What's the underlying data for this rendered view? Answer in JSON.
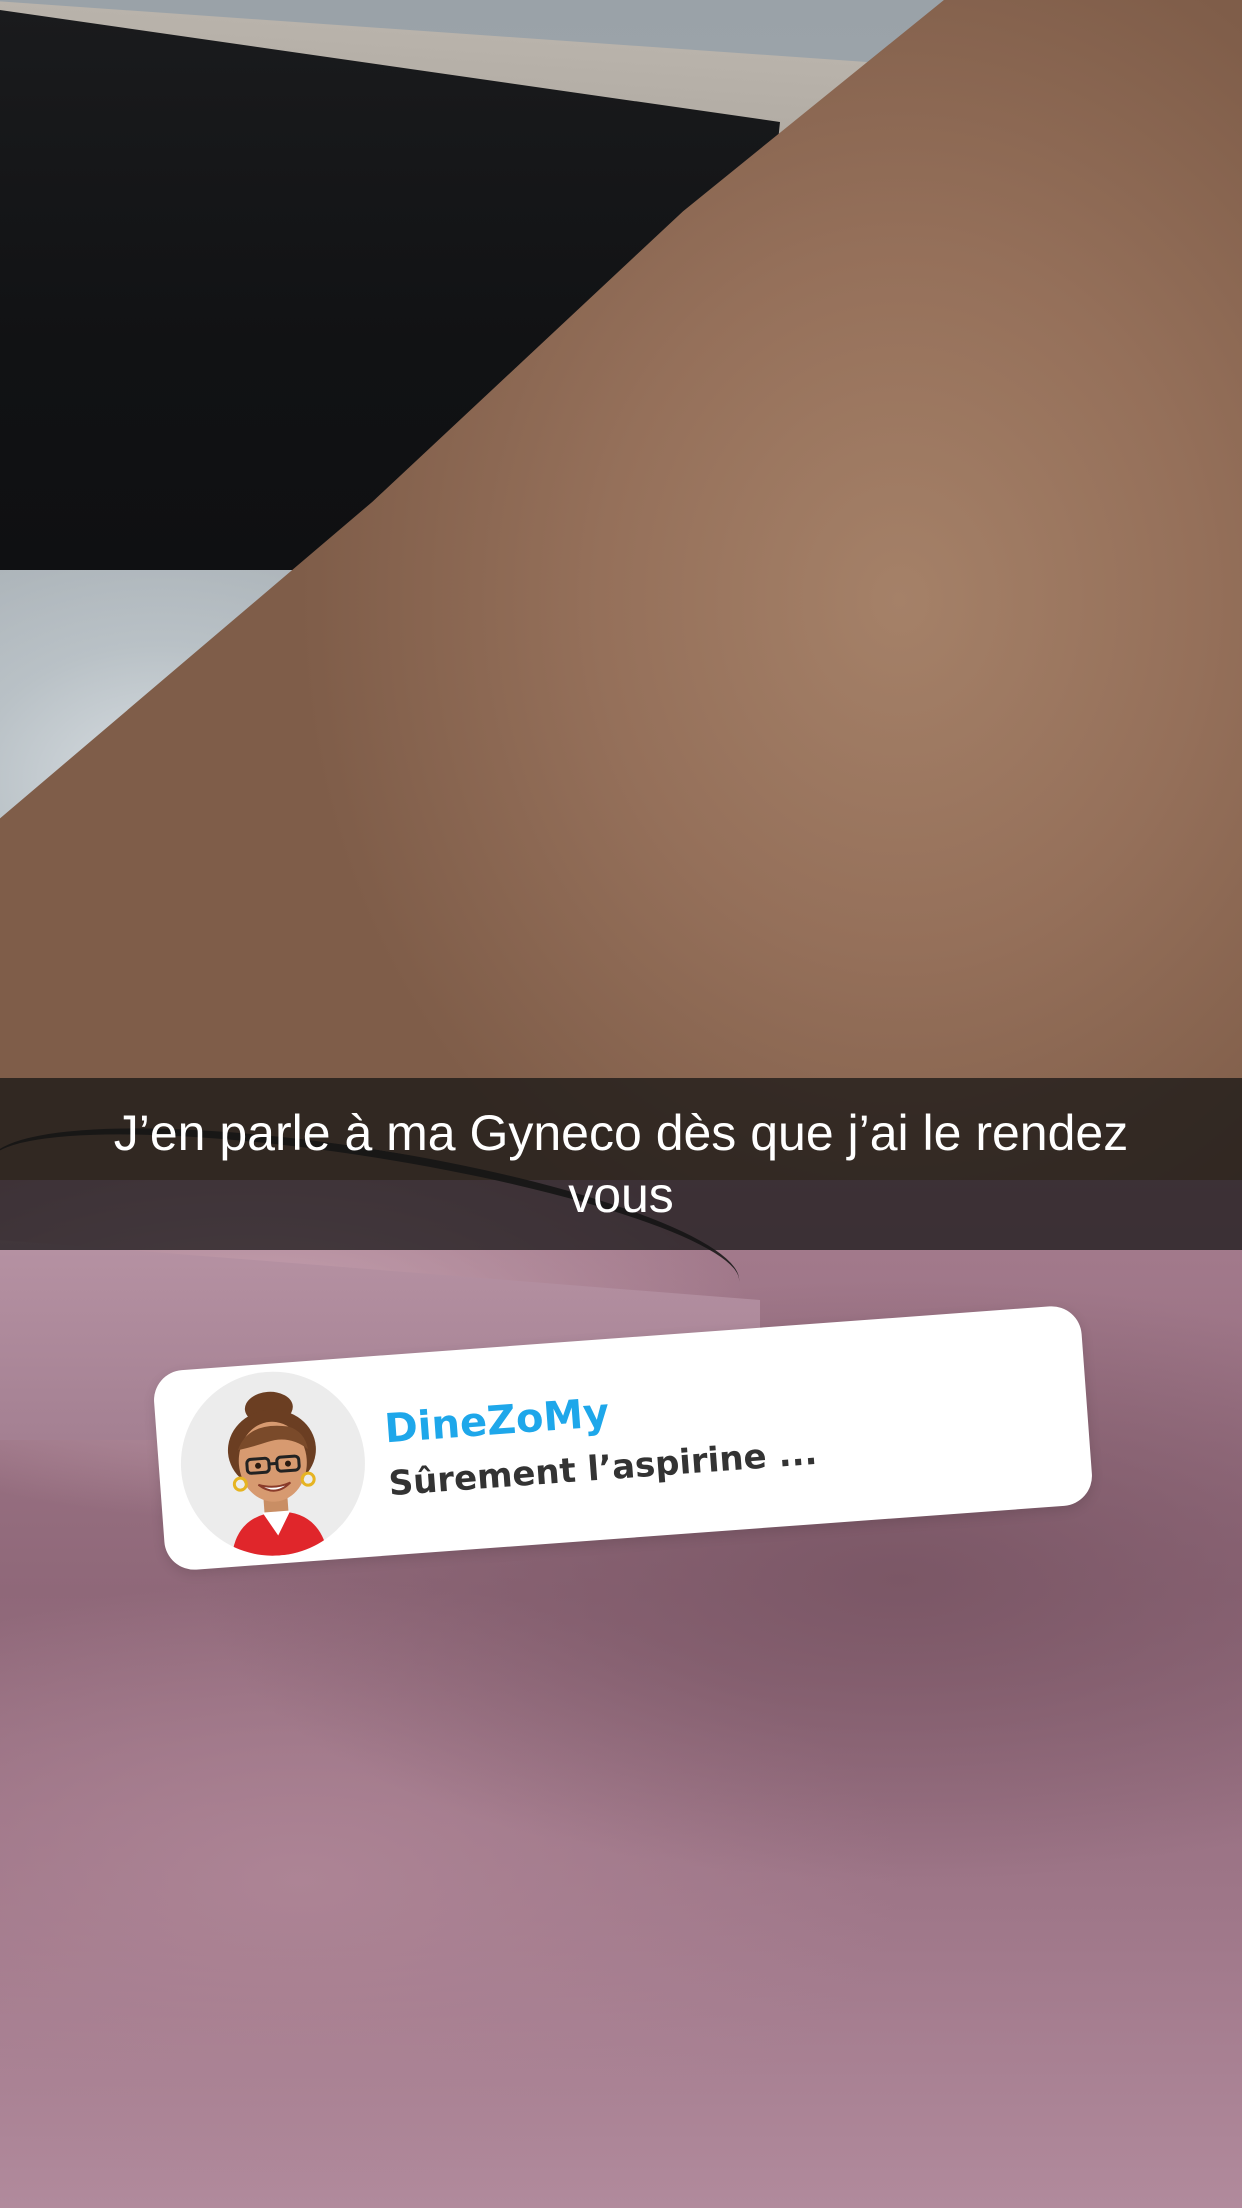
{
  "story": {
    "caption": "J’en parle à ma Gyneco dès que j’ai le rendez vous"
  },
  "reply_sticker": {
    "username": "DineZoMy",
    "message": "Sûrement l’aspirine ...",
    "avatar_icon": "bitmoji-avatar-icon",
    "username_color": "#1ea7ea"
  }
}
